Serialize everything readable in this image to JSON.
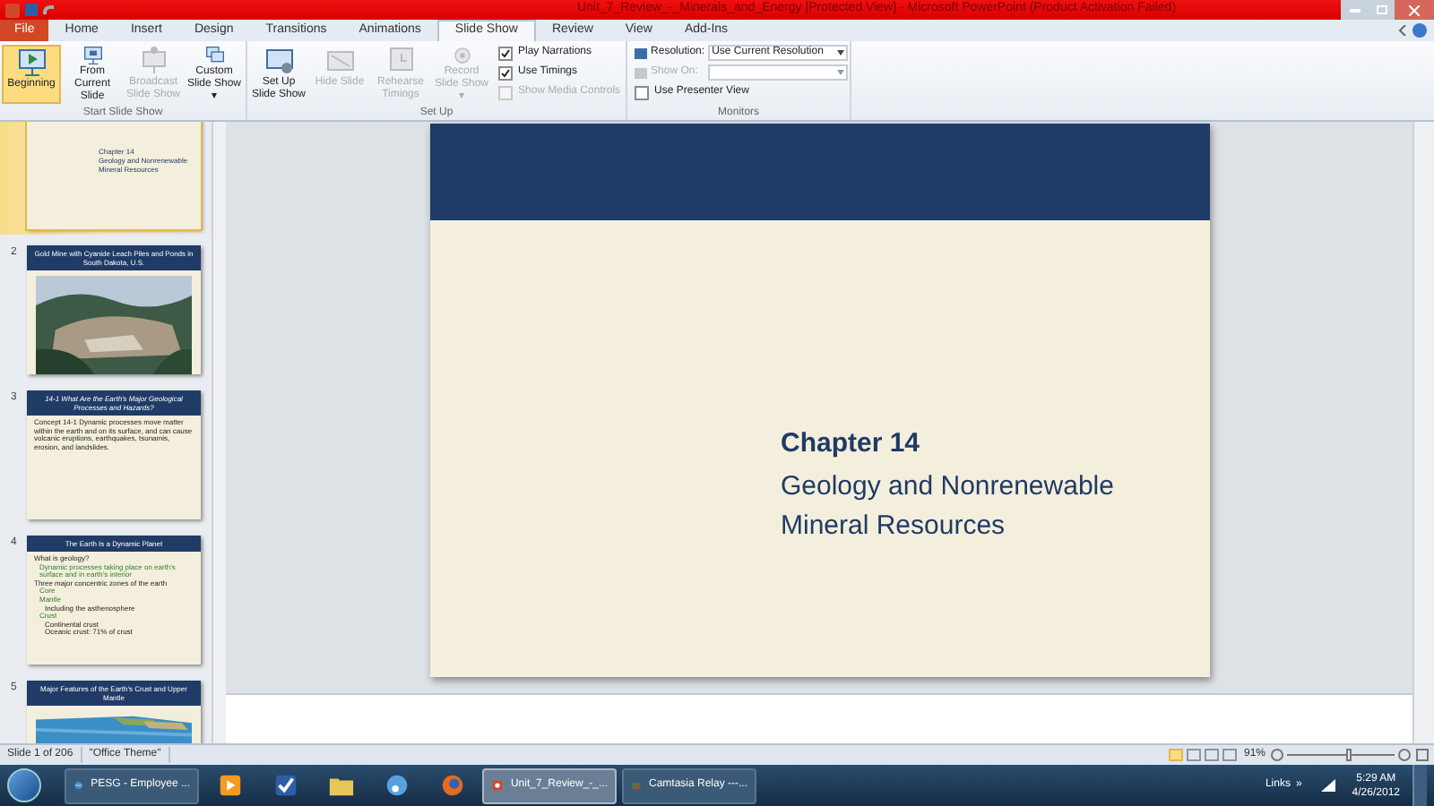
{
  "window": {
    "title": "Unit_7_Review_-_Minerals_and_Energy [Protected View] - Microsoft PowerPoint (Product Activation Failed)"
  },
  "tabs": [
    {
      "label": "File",
      "kind": "file",
      "selected": false
    },
    {
      "label": "Home",
      "kind": "tab",
      "selected": false
    },
    {
      "label": "Insert",
      "kind": "tab",
      "selected": false
    },
    {
      "label": "Design",
      "kind": "tab",
      "selected": false
    },
    {
      "label": "Transitions",
      "kind": "tab",
      "selected": false
    },
    {
      "label": "Animations",
      "kind": "tab",
      "selected": false
    },
    {
      "label": "Slide Show",
      "kind": "tab",
      "selected": true
    },
    {
      "label": "Review",
      "kind": "tab",
      "selected": false
    },
    {
      "label": "View",
      "kind": "tab",
      "selected": false
    },
    {
      "label": "Add-Ins",
      "kind": "tab",
      "selected": false
    }
  ],
  "ribbon": [
    {
      "label": "Start Slide Show",
      "items": [
        {
          "kind": "button",
          "label": "Beginning",
          "disabled": false,
          "selected": true
        },
        {
          "kind": "button",
          "label": "From Current Slide",
          "disabled": false,
          "selected": false
        },
        {
          "kind": "button",
          "label": "Broadcast Slide Show",
          "disabled": true,
          "selected": false
        },
        {
          "kind": "button",
          "label": "Custom Slide Show ▾",
          "disabled": false,
          "selected": false
        }
      ]
    },
    {
      "label": "Set Up",
      "items": [
        {
          "kind": "button",
          "label": "Set Up Slide Show",
          "disabled": false,
          "selected": false
        },
        {
          "kind": "button",
          "label": "Hide Slide",
          "disabled": true,
          "selected": false
        },
        {
          "kind": "button",
          "label": "Rehearse Timings",
          "disabled": true,
          "selected": false
        },
        {
          "kind": "button",
          "label": "Record Slide Show ▾",
          "disabled": true,
          "selected": false
        },
        {
          "kind": "checks",
          "checks": [
            {
              "label": "Play Narrations",
              "checked": true,
              "disabled": false
            },
            {
              "label": "Use Timings",
              "checked": true,
              "disabled": false
            },
            {
              "label": "Show Media Controls",
              "checked": false,
              "disabled": true
            }
          ]
        }
      ]
    },
    {
      "label": "Monitors",
      "items": [
        {
          "kind": "monitors",
          "resolution_label": "Resolution:",
          "resolution_value": "Use Current Resolution",
          "show_on_label": "Show On:",
          "presenter": {
            "label": "Use Presenter View",
            "checked": false
          }
        }
      ]
    }
  ],
  "slides": [
    {
      "selected": true,
      "kind": "title",
      "title": "Chapter 14",
      "subtitle": "Geology and Nonrenewable Mineral Resources"
    },
    {
      "number": "2",
      "selected": false,
      "kind": "picture",
      "title": "Gold Mine with Cyanide Leach Piles and Ponds in South Dakota, U.S."
    },
    {
      "number": "3",
      "selected": false,
      "kind": "bullets",
      "title": "14-1 What Are the Earth's Major Geological Processes and Hazards?",
      "bullets": [
        {
          "text": "Concept 14-1 Dynamic processes move matter within the earth and on its surface, and can cause volcanic eruptions, earthquakes, tsunamis, erosion, and landslides."
        }
      ]
    },
    {
      "number": "4",
      "selected": false,
      "kind": "bullets",
      "title": "The Earth Is a Dynamic Planet",
      "bullets": [
        {
          "text": "What is geology?",
          "children": [
            {
              "text": "Dynamic processes taking place on earth's surface and in earth's interior"
            }
          ]
        },
        {
          "text": "Three major concentric zones of the earth",
          "children": [
            {
              "text": "Core"
            },
            {
              "text": "Mantle",
              "children": [
                {
                  "text": "Including the asthenosphere"
                }
              ]
            },
            {
              "text": "Crust",
              "children": [
                {
                  "text": "Continental crust"
                },
                {
                  "text": "Oceanic crust: 71% of crust"
                }
              ]
            }
          ]
        }
      ]
    },
    {
      "number": "5",
      "selected": false,
      "kind": "picture",
      "title": "Major Features of the Earth's Crust and Upper Mantle"
    }
  ],
  "current_slide": {
    "title": "Chapter 14",
    "subtitle": "Geology and Nonrenewable Mineral Resources"
  },
  "status_bar": {
    "slide": "Slide 1 of 206",
    "theme": "\"Office Theme\"",
    "zoom": "91%",
    "zoom_slider": {
      "level": 0.55
    }
  },
  "taskbar": {
    "items": [
      {
        "label": "PESG - Employee ...",
        "selected": false
      },
      {
        "selected": false
      },
      {
        "selected": false
      },
      {
        "selected": false
      },
      {
        "selected": false
      },
      {
        "selected": false
      },
      {
        "label": "Unit_7_Review_-_...",
        "selected": true
      },
      {
        "label": "Camtasia Relay ---...",
        "selected": false
      }
    ],
    "links": "Links",
    "more": "»",
    "time": "5:29 AM",
    "date": "4/26/2012"
  }
}
